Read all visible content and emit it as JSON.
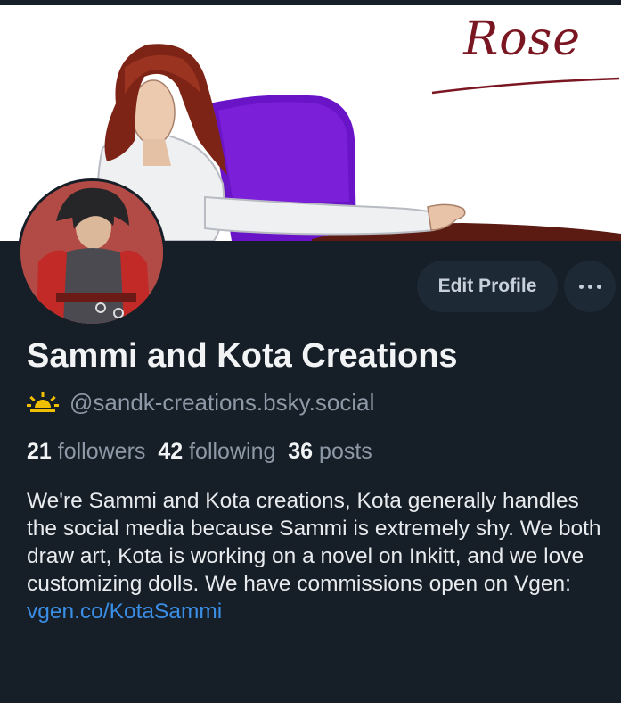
{
  "banner": {
    "signature": "Rose"
  },
  "profile": {
    "display_name": "Sammi and Kota Creations",
    "handle": "@sandk-creations.bsky.social",
    "edit_label": "Edit Profile",
    "more_label": "···",
    "followers_count": "21",
    "followers_label": "followers",
    "following_count": "42",
    "following_label": "following",
    "posts_count": "36",
    "posts_label": "posts",
    "bio_text": "We're Sammi and Kota creations, Kota generally handles the social media because Sammi is extremely shy. We both draw art, Kota is working on a novel on Inkitt, and we love customizing dolls. We have commissions open on Vgen: ",
    "bio_link": "vgen.co/​KotaSammi"
  },
  "icons": {
    "handle_badge": "sun-icon",
    "more": "more-dots-icon"
  },
  "colors": {
    "background": "#161e27",
    "text_primary": "#f1f3f5",
    "text_secondary": "#8d99a6",
    "link": "#3b8ee6",
    "button_bg": "#1e2936",
    "badge": "#f0c000"
  }
}
